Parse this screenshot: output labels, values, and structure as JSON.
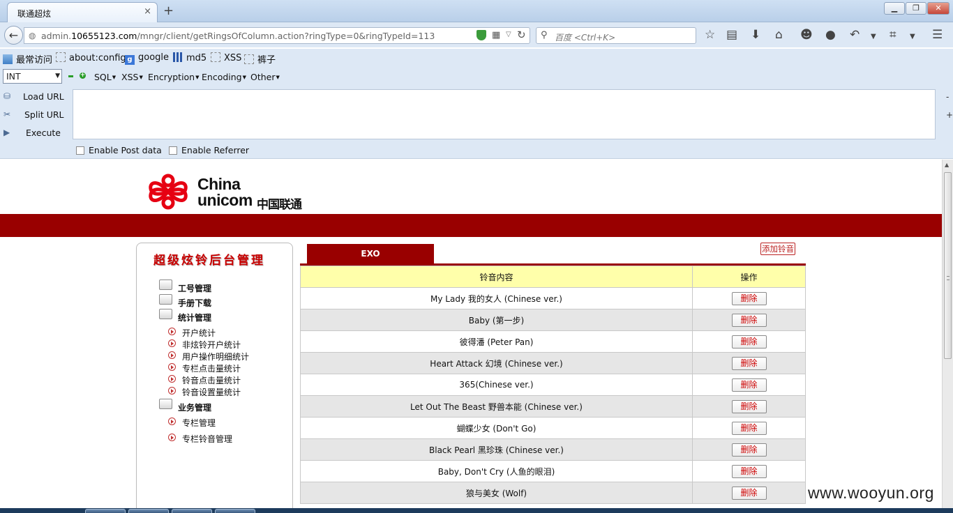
{
  "browser": {
    "tab_title": "联通超炫",
    "tab_close": "×",
    "new_tab": "+",
    "url_prefix": "admin.",
    "url_domain": "10655123.com",
    "url_path": "/mngr/client/getRingsOfColumn.action?ringType=0&ringTypeId=113",
    "search_placeholder": "百度 <Ctrl+K>",
    "win_min": "▁",
    "win_max": "❐",
    "win_close": "✕",
    "nav_icons": [
      "star-icon",
      "clipboard-icon",
      "download-icon",
      "home-icon",
      "chat-smile-icon",
      "chat-bubble-icon",
      "undo-icon",
      "dropdown-icon",
      "crop-icon",
      "dropdown-icon",
      "menu-icon"
    ]
  },
  "bookmarks": [
    {
      "label": "最常访问",
      "icon": "folder-icon"
    },
    {
      "label": "about:config",
      "icon": "page-icon"
    },
    {
      "label": "google",
      "icon": "google-icon"
    },
    {
      "label": "md5",
      "icon": "grid-icon"
    },
    {
      "label": "XSS",
      "icon": "page-icon"
    },
    {
      "label": "裤子",
      "icon": "page-icon"
    }
  ],
  "hackbar": {
    "select_value": "INT",
    "menus": [
      "SQL",
      "XSS",
      "Encryption",
      "Encoding",
      "Other"
    ],
    "actions": [
      "Load URL",
      "Split URL",
      "Execute"
    ],
    "side_minus": "-",
    "side_plus": "+",
    "enable_post": "Enable Post data",
    "enable_referrer": "Enable Referrer"
  },
  "logo": {
    "china": "China",
    "unicom": "unicom",
    "cn": "中国联通",
    "brand_color": "#e60012"
  },
  "sidebar": {
    "title": "超级炫铃后台管理",
    "groups": [
      {
        "label": "工号管理",
        "items": []
      },
      {
        "label": "手册下载",
        "items": []
      },
      {
        "label": "统计管理",
        "items": [
          "开户统计",
          "非炫铃开户统计",
          "用户操作明细统计",
          "专栏点击量统计",
          "铃音点击量统计",
          "铃音设置量统计"
        ]
      },
      {
        "label": "业务管理",
        "items": [
          "专栏管理",
          "专栏铃音管理"
        ]
      }
    ]
  },
  "main": {
    "tab_label": "EXO",
    "add_button": "添加铃音",
    "columns": [
      "铃音内容",
      "操作"
    ],
    "delete_label": "删除",
    "rows": [
      "My Lady 我的女人 (Chinese ver.)",
      "Baby (第一步)",
      "彼得潘 (Peter Pan)",
      "Heart Attack 幻境 (Chinese ver.)",
      "365(Chinese ver.)",
      "Let Out The Beast 野兽本能 (Chinese ver.)",
      "蝴蝶少女 (Don't Go)",
      "Black Pearl 黑珍珠 (Chinese ver.)",
      "Baby, Don't Cry (人鱼的眼泪)",
      "狼与美女 (Wolf)"
    ]
  },
  "colors": {
    "header_band": "#990000",
    "table_header": "#ffffaa",
    "alt_row": "#e6e6e6",
    "sidebar_title": "#c80000"
  },
  "watermark": "www.wooyun.org"
}
